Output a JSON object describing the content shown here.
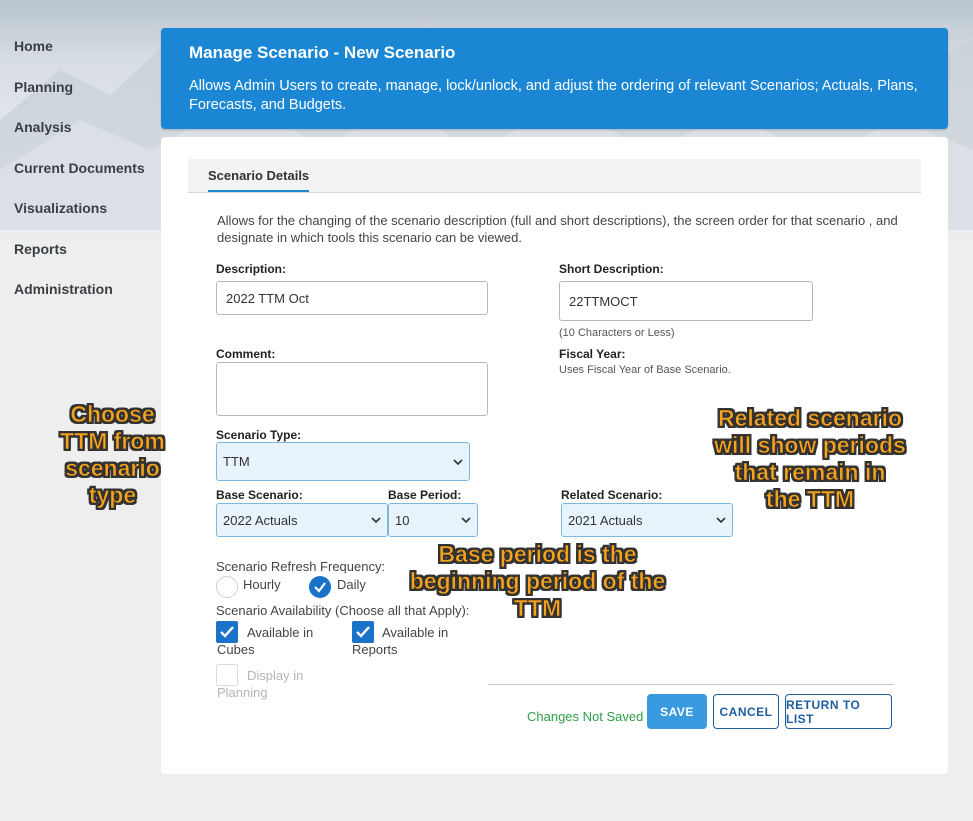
{
  "nav": {
    "items": [
      {
        "label": "Home"
      },
      {
        "label": "Planning"
      },
      {
        "label": "Analysis"
      },
      {
        "label": "Current Documents"
      },
      {
        "label": "Visualizations"
      },
      {
        "label": "Reports"
      },
      {
        "label": "Administration"
      }
    ]
  },
  "header": {
    "title": "Manage Scenario - New Scenario",
    "description": "Allows Admin Users to create, manage, lock/unlock, and adjust the ordering of relevant Scenarios; Actuals, Plans, Forecasts, and Budgets."
  },
  "tabs": [
    {
      "label": "Scenario Details",
      "active": true
    }
  ],
  "intro": "Allows for the changing of the scenario description (full and short descriptions), the screen order for that scenario , and designate in which tools this scenario can be viewed.",
  "form": {
    "description": {
      "label": "Description:",
      "value": "2022 TTM Oct"
    },
    "short_description": {
      "label": "Short Description:",
      "value": "22TTMOCT",
      "hint": "(10 Characters or Less)"
    },
    "comment": {
      "label": "Comment:",
      "value": ""
    },
    "fiscal_year": {
      "label": "Fiscal Year:",
      "hint": "Uses Fiscal Year of Base Scenario."
    },
    "scenario_type": {
      "label": "Scenario Type:",
      "value": "TTM"
    },
    "base_scenario": {
      "label": "Base Scenario:",
      "value": "2022 Actuals"
    },
    "base_period": {
      "label": "Base Period:",
      "value": "10"
    },
    "related_scenario": {
      "label": "Related Scenario:",
      "value": "2021 Actuals"
    },
    "refresh_frequency": {
      "label": "Scenario Refresh Frequency:",
      "options": [
        {
          "label": "Hourly",
          "selected": false
        },
        {
          "label": "Daily",
          "selected": true
        }
      ]
    },
    "availability": {
      "label": "Scenario Availability (Choose all that Apply):",
      "options": [
        {
          "line1": "Available in",
          "line2": "Cubes",
          "checked": true,
          "disabled": false
        },
        {
          "line1": "Available in",
          "line2": "Reports",
          "checked": true,
          "disabled": false
        },
        {
          "line1": "Display in",
          "line2": "Planning",
          "checked": false,
          "disabled": true
        }
      ]
    }
  },
  "footer": {
    "status": "Changes Not Saved",
    "save_label": "SAVE",
    "cancel_label": "CANCEL",
    "return_label": "RETURN TO LIST"
  },
  "annotations": {
    "ttm": [
      "Choose",
      "TTM from",
      "scenario",
      "type"
    ],
    "related": [
      "Related scenario",
      "will show periods",
      "that remain in",
      "the TTM"
    ],
    "base_period": [
      "Base period is the",
      "beginning period of the",
      "TTM"
    ]
  },
  "colors": {
    "banner": "#1a86d4",
    "select_bg": "#e8f4fb",
    "checked": "#1a73c8",
    "status": "#2e9e4a",
    "annotation": "#f5a31e"
  }
}
